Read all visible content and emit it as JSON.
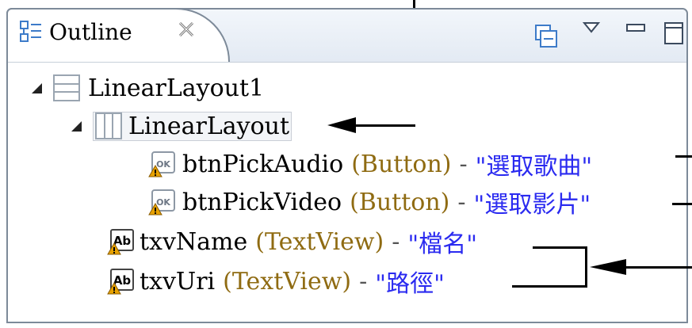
{
  "tab": {
    "title": "Outline",
    "close_glyph": "✕"
  },
  "tree": {
    "root": {
      "name": "LinearLayout1"
    },
    "child": {
      "name": "LinearLayout"
    },
    "buttons": [
      {
        "id": "btnPickAudio",
        "type": "(Button)",
        "sep": "-",
        "text": "\"選取歌曲\""
      },
      {
        "id": "btnPickVideo",
        "type": "(Button)",
        "sep": "-",
        "text": "\"選取影片\""
      }
    ],
    "textviews": [
      {
        "id": "txvName",
        "type": "(TextView)",
        "sep": "-",
        "text": "\"檔名\""
      },
      {
        "id": "txvUri",
        "type": "(TextView)",
        "sep": "-",
        "text": "\"路徑\""
      }
    ]
  },
  "icons": {
    "tab": "outline-icon",
    "layout_horizontal": "linear-layout-vertical-icon",
    "layout_vertical": "linear-layout-horizontal-icon",
    "button": "button-warning-icon",
    "textview": "textview-warning-icon",
    "collapse_all": "collapse-all-icon",
    "view_menu": "view-menu-icon",
    "minimize": "minimize-icon",
    "maximize": "maximize-icon"
  },
  "colors": {
    "type": "#8f6b12",
    "string": "#2a2af0",
    "icon_blue": "#3d7bc9",
    "warning": "#e8a200"
  },
  "button_icon_text": "OK",
  "textview_icon_text": "Ab"
}
